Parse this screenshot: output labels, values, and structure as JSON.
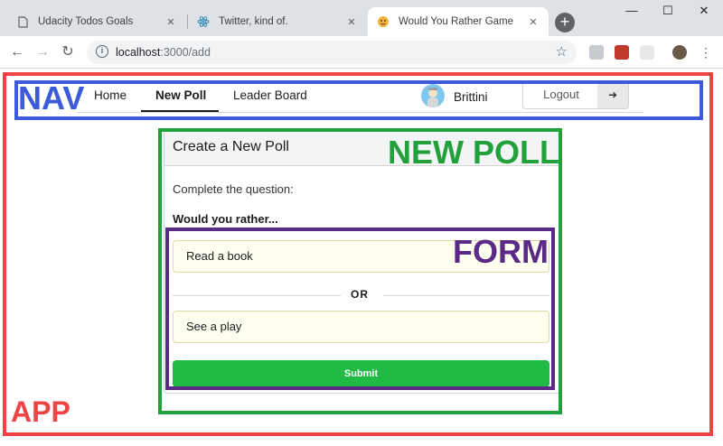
{
  "browser": {
    "tabs": [
      {
        "title": "Udacity Todos Goals"
      },
      {
        "title": "Twitter, kind of."
      },
      {
        "title": "Would You Rather Game"
      }
    ],
    "url_host": "localhost",
    "url_path": ":3000/add",
    "new_tab_label": "+"
  },
  "nav": {
    "items": [
      {
        "label": "Home"
      },
      {
        "label": "New Poll"
      },
      {
        "label": "Leader Board"
      }
    ],
    "username": "Brittini",
    "logout_label": "Logout"
  },
  "poll": {
    "title": "Create a New Poll",
    "prompt": "Complete the question:",
    "question": "Would you rather...",
    "option_one": "Read a book",
    "or_label": "OR",
    "option_two": "See a play",
    "submit_label": "Submit"
  },
  "annotations": {
    "app": "APP",
    "nav": "NAV",
    "new_poll": "NEW POLL",
    "form": "FORM"
  },
  "colors": {
    "app_box": "#ef4444",
    "nav_box": "#3b5bdb",
    "new_poll_box": "#22a03c",
    "form_box": "#5b2a86",
    "submit": "#21ba45"
  }
}
